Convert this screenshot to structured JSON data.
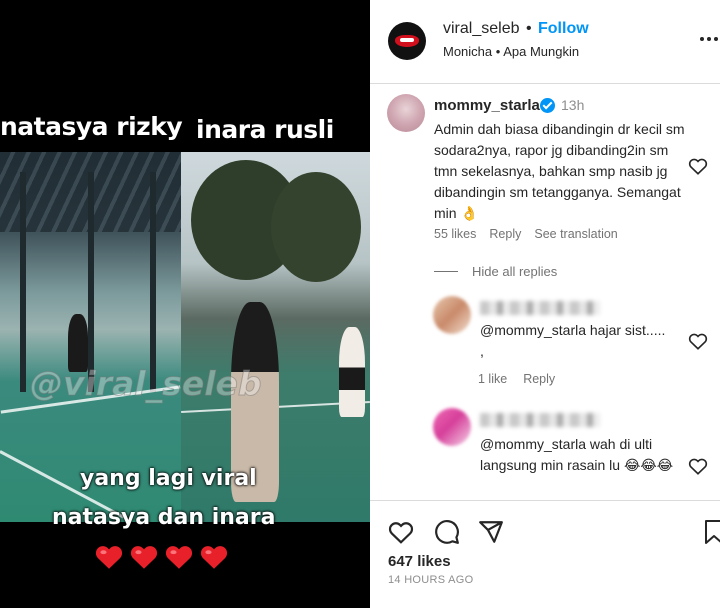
{
  "video": {
    "caption_left_name": "natasya rizky",
    "caption_right_name": "inara rusli",
    "watermark": "@viral_seleb",
    "caption_line1": "yang lagi viral",
    "caption_line2": "natasya dan inara",
    "hearts_count": 4,
    "heart_color": "#e8202a"
  },
  "post_header": {
    "username": "viral_seleb",
    "separator": "•",
    "follow_label": "Follow",
    "audio": "Monicha • Apa Mungkin",
    "more_icon": "more-horizontal-icon"
  },
  "comment": {
    "username": "mommy_starla",
    "verified": true,
    "time": "13h",
    "text": "Admin dah biasa dibandingin dr kecil sm sodara2nya, rapor jg dibanding2in sm tmn sekelasnya, bahkan smp nasib jg dibandingin sm tetangganya. Semangat min 👌",
    "likes": "55 likes",
    "reply_label": "Reply",
    "translate_label": "See translation",
    "hide_replies_label": "Hide all replies"
  },
  "replies": [
    {
      "text": "@mommy_starla hajar sist.....\n,",
      "likes": "1 like",
      "reply_label": "Reply"
    },
    {
      "text": "@mommy_starla wah di ulti langsung min rasain lu 😂😂😂"
    }
  ],
  "post_actions": {
    "like_icon": "heart-icon",
    "comment_icon": "comment-icon",
    "share_icon": "send-icon",
    "save_icon": "bookmark-icon",
    "likes": "647 likes",
    "time_ago": "14 HOURS AGO"
  },
  "colors": {
    "link_blue": "#0095f6",
    "muted_text": "#737373",
    "divider": "#dbdbdb"
  }
}
